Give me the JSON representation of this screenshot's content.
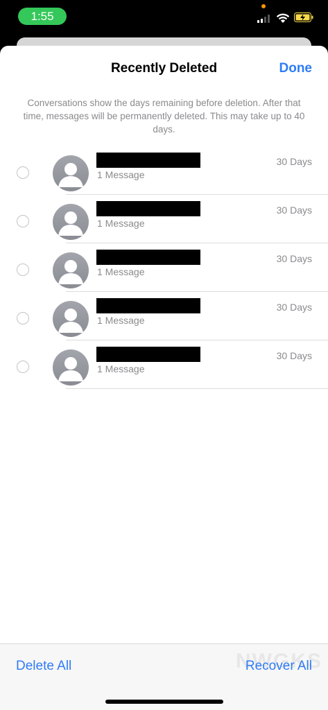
{
  "status_bar": {
    "time": "1:55"
  },
  "sheet": {
    "title": "Recently Deleted",
    "done_label": "Done",
    "info_text": "Conversations show the days remaining before deletion. After that time, messages will be permanently deleted. This may take up to 40 days."
  },
  "conversations": [
    {
      "message_count": "1 Message",
      "days_remaining": "30 Days"
    },
    {
      "message_count": "1 Message",
      "days_remaining": "30 Days"
    },
    {
      "message_count": "1 Message",
      "days_remaining": "30 Days"
    },
    {
      "message_count": "1 Message",
      "days_remaining": "30 Days"
    },
    {
      "message_count": "1 Message",
      "days_remaining": "30 Days"
    }
  ],
  "toolbar": {
    "delete_all_label": "Delete All",
    "recover_all_label": "Recover All"
  },
  "watermark": {
    "text": "NWGKS"
  },
  "colors": {
    "accent": "#2f7cf6",
    "status_time_pill": "#34c759",
    "secondary_text": "#8a8a8e"
  },
  "icons": {
    "avatar": "person-silhouette-icon",
    "wifi": "wifi-icon",
    "signal": "cellular-signal-icon",
    "battery": "battery-charging-icon"
  }
}
